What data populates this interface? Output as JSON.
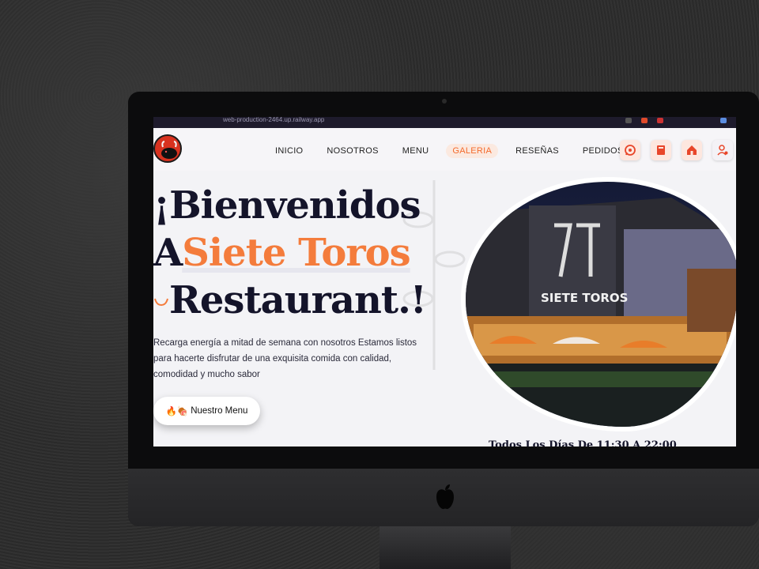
{
  "browser": {
    "url": "web-production-2464.up.railway.app"
  },
  "nav": {
    "items": [
      {
        "label": "INICIO",
        "active": false
      },
      {
        "label": "NOSOTROS",
        "active": false
      },
      {
        "label": "MENU",
        "active": false
      },
      {
        "label": "GALERIA",
        "active": true
      },
      {
        "label": "RESEÑAS",
        "active": false
      },
      {
        "label": "PEDIDOS",
        "active": false
      }
    ],
    "icons": [
      "whatsapp-icon",
      "book-icon",
      "home-icon",
      "user-icon"
    ]
  },
  "hero": {
    "line1": "¡Bienvenidos",
    "line2_prefix": "A",
    "line2_accent": "Siete Toros",
    "line3": "Restaurant.!",
    "description": "Recarga energía a mitad de semana con nosotros Estamos listos para hacerte disfrutar de una exquisita comida con calidad, comodidad y mucho sabor",
    "button_label": "Nuestro Menu",
    "button_emojis": "🔥🍖",
    "hours": "Todos Los Días De 11:30 A 22:00",
    "photo_sign": "SIETE TOROS"
  },
  "colors": {
    "accent": "#f47c3c",
    "heading": "#14142a",
    "nav_active_bg": "#fbe9e0",
    "icon_red": "#e8462a"
  }
}
